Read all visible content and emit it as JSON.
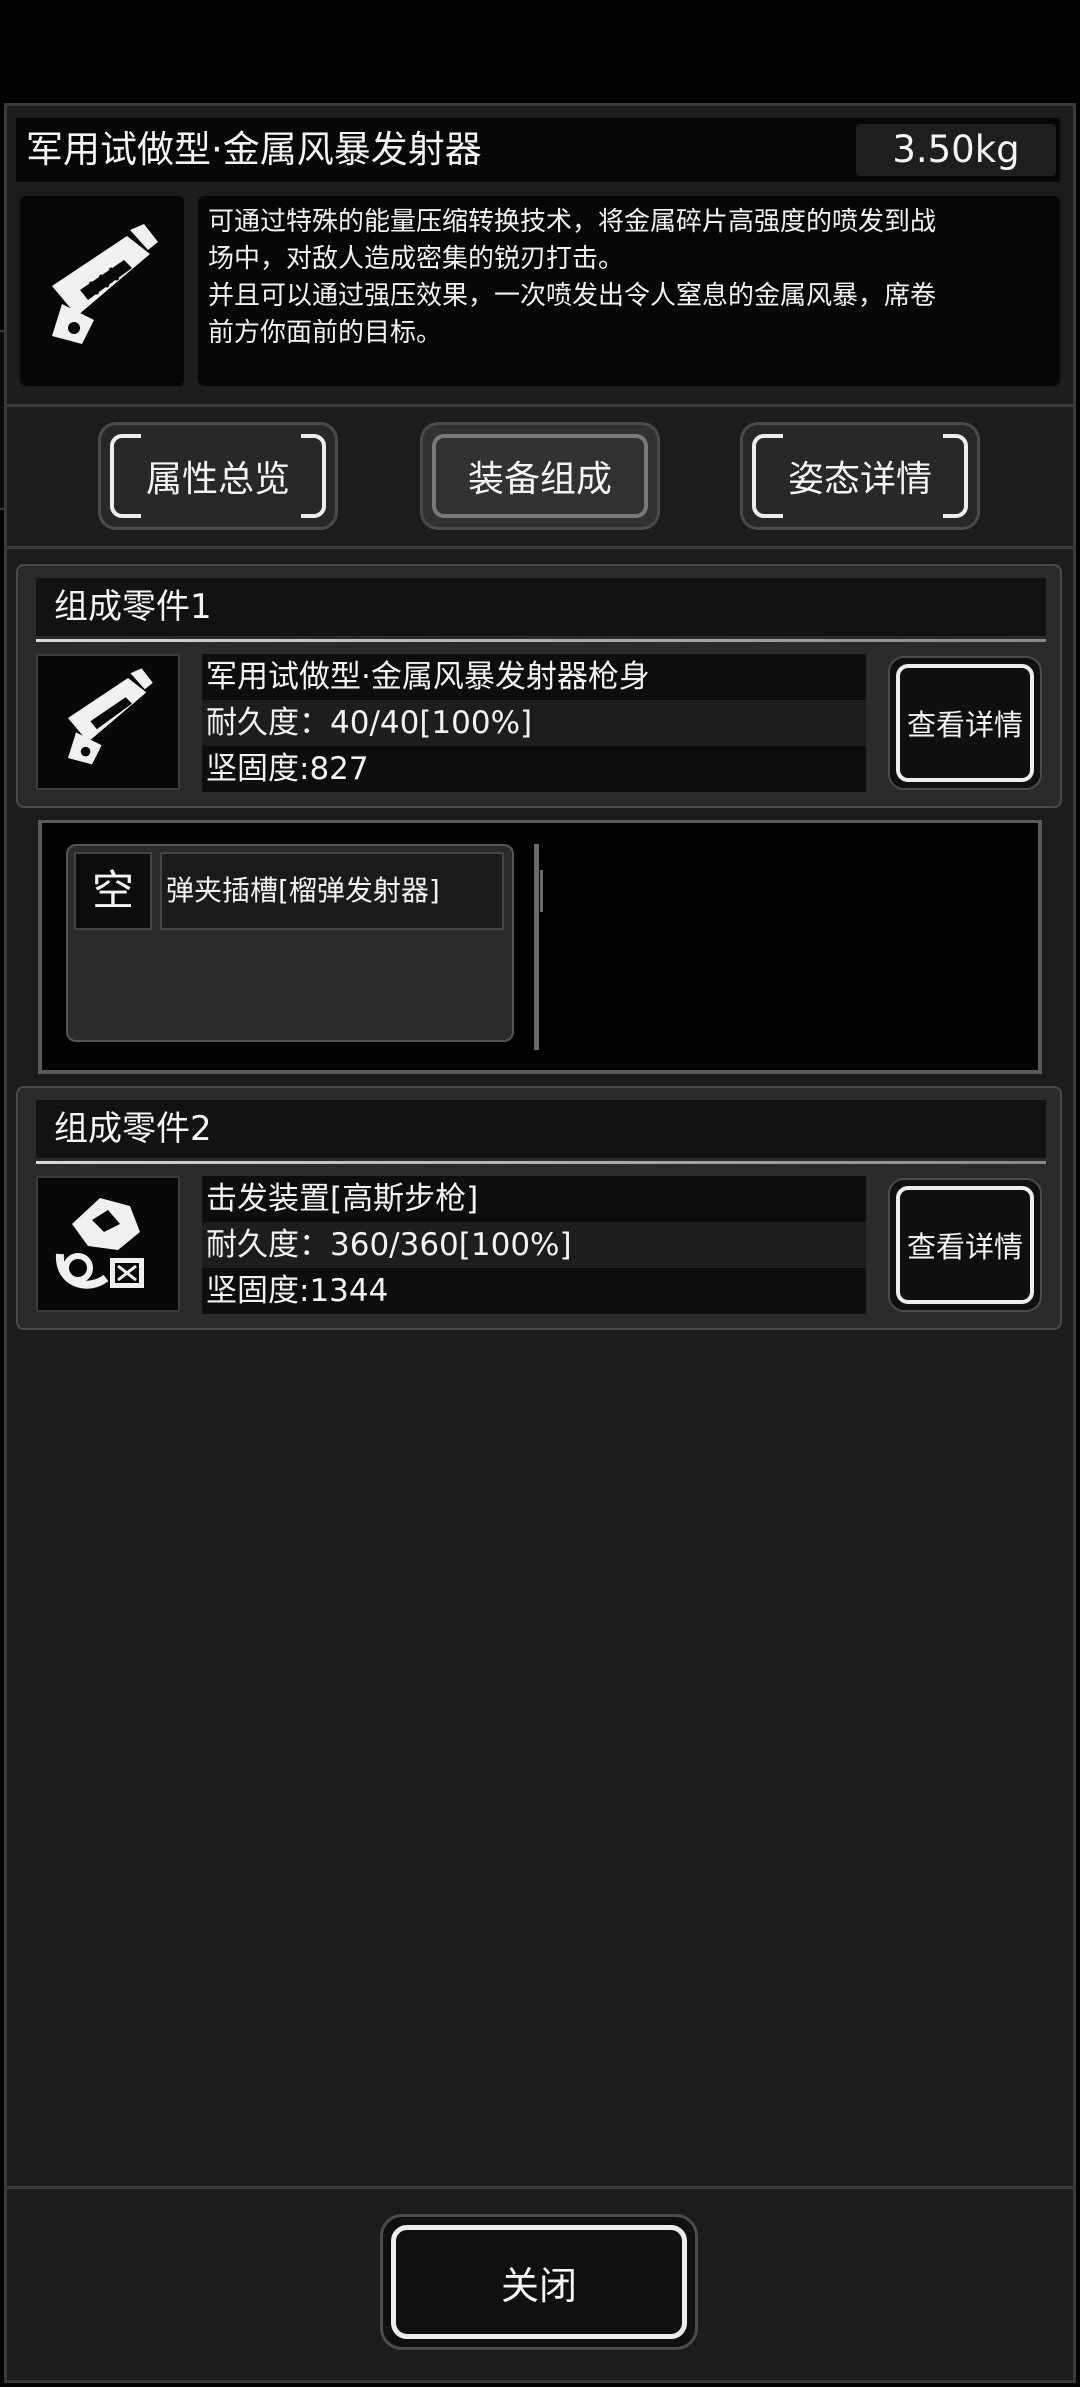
{
  "header": {
    "title": "军用试做型·金属风暴发射器",
    "weight": "3.50kg",
    "item_icon": "metal-storm-launcher-icon",
    "description": [
      "可通过特殊的能量压缩转换技术，将金属碎片高强度的喷发到战",
      "场中，对敌人造成密集的锐刃打击。",
      "并且可以通过强压效果，一次喷发出令人窒息的金属风暴，席卷",
      "前方你面前的目标。"
    ]
  },
  "tabs": [
    {
      "label": "属性总览",
      "active": false
    },
    {
      "label": "装备组成",
      "active": true
    },
    {
      "label": "姿态详情",
      "active": false
    }
  ],
  "components": [
    {
      "header": "组成零件1",
      "icon": "launcher-body-icon",
      "name": "军用试做型·金属风暴发射器枪身",
      "durability": "耐久度：40/40[100%]",
      "hardness": "坚固度:827",
      "detail_label": "查看详情"
    },
    {
      "header": "组成零件2",
      "icon": "firing-mechanism-icon",
      "name": "击发装置[高斯步枪]",
      "durability": "耐久度：360/360[100%]",
      "hardness": "坚固度:1344",
      "detail_label": "查看详情"
    }
  ],
  "slot": {
    "empty_label": "空",
    "name": "弹夹插槽[榴弹发射器]"
  },
  "footer": {
    "close_label": "关闭"
  },
  "colors": {
    "panel_bg": "#1c1c1c",
    "card_bg": "#2a2a2a",
    "row_dark": "#0d0d0d",
    "button_border": "#ededed"
  }
}
